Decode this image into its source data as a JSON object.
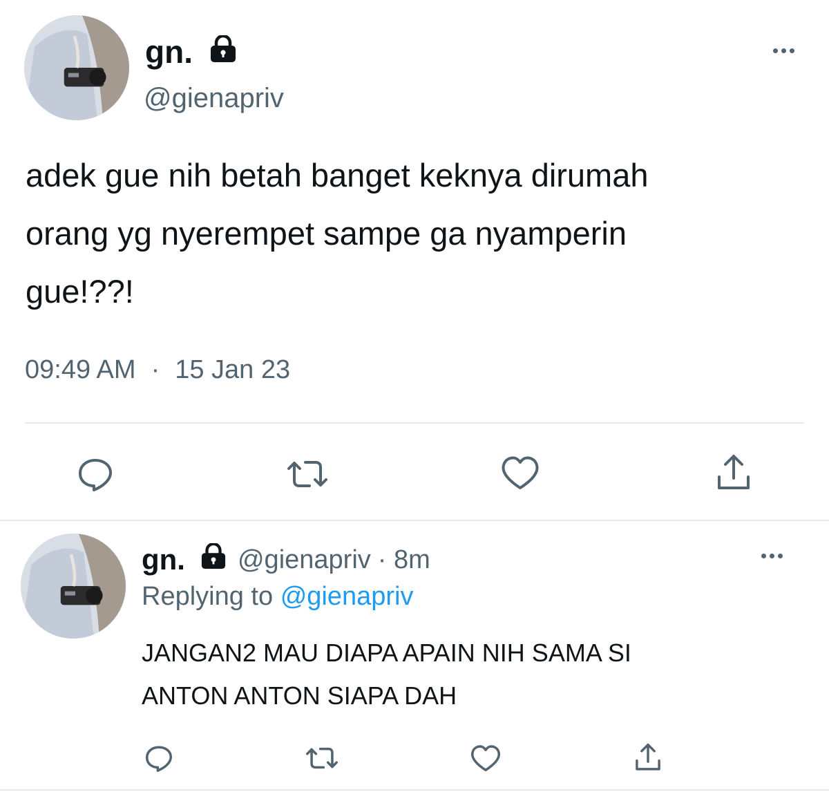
{
  "main_tweet": {
    "display_name": "gn.",
    "handle": "@gienapriv",
    "text_lines": [
      "adek gue nih betah banget keknya dirumah",
      "orang yg nyerempet sampe ga nyamperin",
      "gue!??!"
    ],
    "time": "09:49 AM",
    "separator": "·",
    "date": "15 Jan 23",
    "icons": [
      "lock-icon",
      "more-icon",
      "reply-icon",
      "retweet-icon",
      "like-icon",
      "share-icon"
    ]
  },
  "reply_tweet": {
    "display_name": "gn.",
    "handle": "@gienapriv",
    "time_ago": "· 8m",
    "replying_prefix": "Replying to",
    "replying_to": "@gienapriv",
    "text_lines": [
      "JANGAN2 MAU DIAPA APAIN NIH SAMA SI",
      "ANTON ANTON SIAPA DAH"
    ]
  },
  "colors": {
    "text": "#0f1419",
    "secondary": "#536471",
    "link": "#1d9bf0",
    "divider": "#e6e9ec"
  }
}
